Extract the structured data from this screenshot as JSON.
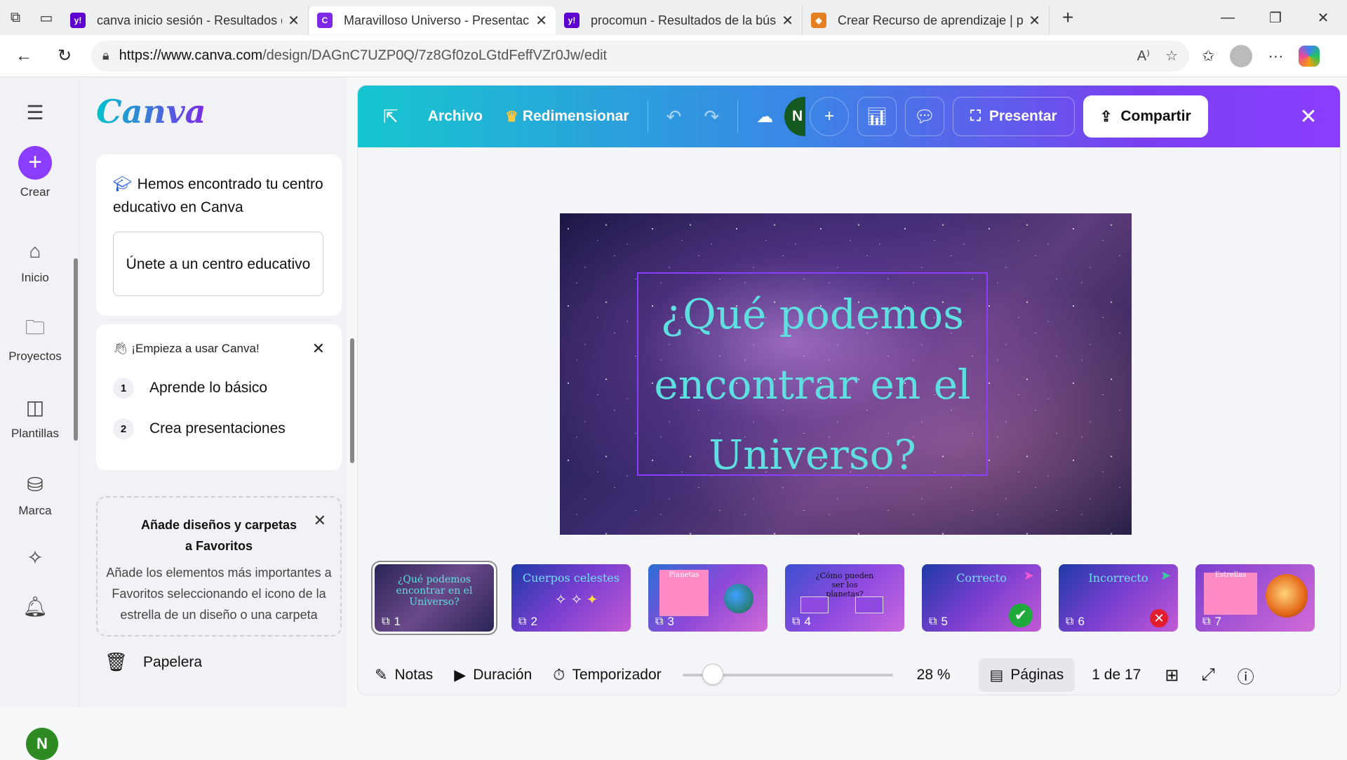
{
  "browser": {
    "tabs": [
      {
        "title": "canva inicio sesión - Resultados de",
        "fav_color": "#5f01d1",
        "fav_text": "y!"
      },
      {
        "title": "Maravilloso Universo - Presentación",
        "fav_color": "#7d2ae8",
        "fav_text": "C",
        "active": true
      },
      {
        "title": "procomun - Resultados de la búsq",
        "fav_color": "#5f01d1",
        "fav_text": "y!"
      },
      {
        "title": "Crear Recurso de aprendizaje | pro",
        "fav_color": "#e67e22",
        "fav_text": "◆"
      }
    ],
    "url_host": "https://www.canva.com",
    "url_path": "/design/DAGnC7UZP0Q/7z8Gf0zoLGtdFeffVZr0Jw/edit"
  },
  "rail": {
    "crear": "Crear",
    "inicio": "Inicio",
    "proyectos": "Proyectos",
    "plantillas": "Plantillas",
    "marca": "Marca",
    "avatar_initial": "N"
  },
  "panel": {
    "logo": "Canva",
    "edu_heading": "Hemos encontrado tu centro educativo en Canva",
    "join_button": "Únete a un centro educativo",
    "start_heading": "¡Empieza a usar Canva!",
    "steps": [
      {
        "num": "1",
        "label": "Aprende lo básico"
      },
      {
        "num": "2",
        "label": "Crea presentaciones"
      }
    ],
    "fav_title": "Añade diseños y carpetas a Favoritos",
    "fav_desc": "Añade los elementos más importantes a Favoritos seleccionando el icono de la estrella de un diseño o una carpeta",
    "trash": "Papelera"
  },
  "editor": {
    "archivo": "Archivo",
    "redimensionar": "Redimensionar",
    "collab_initial": "N",
    "presentar": "Presentar",
    "compartir": "Compartir",
    "slide_title": "¿Qué podemos encontrar en el Universo?",
    "thumbnails": [
      {
        "num": "1",
        "title": "¿Qué podemos encontrar en el Universo?"
      },
      {
        "num": "2",
        "title": "Cuerpos celestes"
      },
      {
        "num": "3",
        "title": "Planetas"
      },
      {
        "num": "4",
        "title": "¿Cómo pueden ser los planetas?"
      },
      {
        "num": "5",
        "title": "Correcto"
      },
      {
        "num": "6",
        "title": "Incorrecto"
      },
      {
        "num": "7",
        "title": "Estrellas"
      }
    ],
    "notas": "Notas",
    "duracion": "Duración",
    "temporizador": "Temporizador",
    "zoom_value": 28,
    "zoom": "28 %",
    "paginas": "Páginas",
    "page_count": "1 de 17"
  }
}
